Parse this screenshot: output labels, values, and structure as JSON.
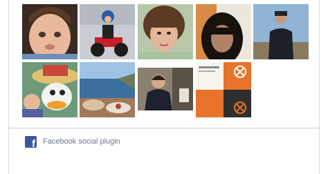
{
  "plugin": {
    "label": "Facebook social plugin",
    "brand_color": "#3b5998"
  },
  "fans": [
    {
      "row": 1,
      "col": 1,
      "kind": "baby portrait"
    },
    {
      "row": 1,
      "col": 2,
      "kind": "child on red quad bike"
    },
    {
      "row": 1,
      "col": 3,
      "kind": "woman with bangs"
    },
    {
      "row": 1,
      "col": 4,
      "kind": "woman in dark light"
    },
    {
      "row": 1,
      "col": 5,
      "kind": "man in cap outdoors"
    },
    {
      "row": 2,
      "col": 1,
      "kind": "sombrero duck costume"
    },
    {
      "row": 2,
      "col": 2,
      "kind": "sea view with food"
    },
    {
      "row": 2,
      "col": 3,
      "kind": "man indoors"
    },
    {
      "row": 2,
      "col": 4,
      "kind": "orange logo tiles"
    }
  ]
}
